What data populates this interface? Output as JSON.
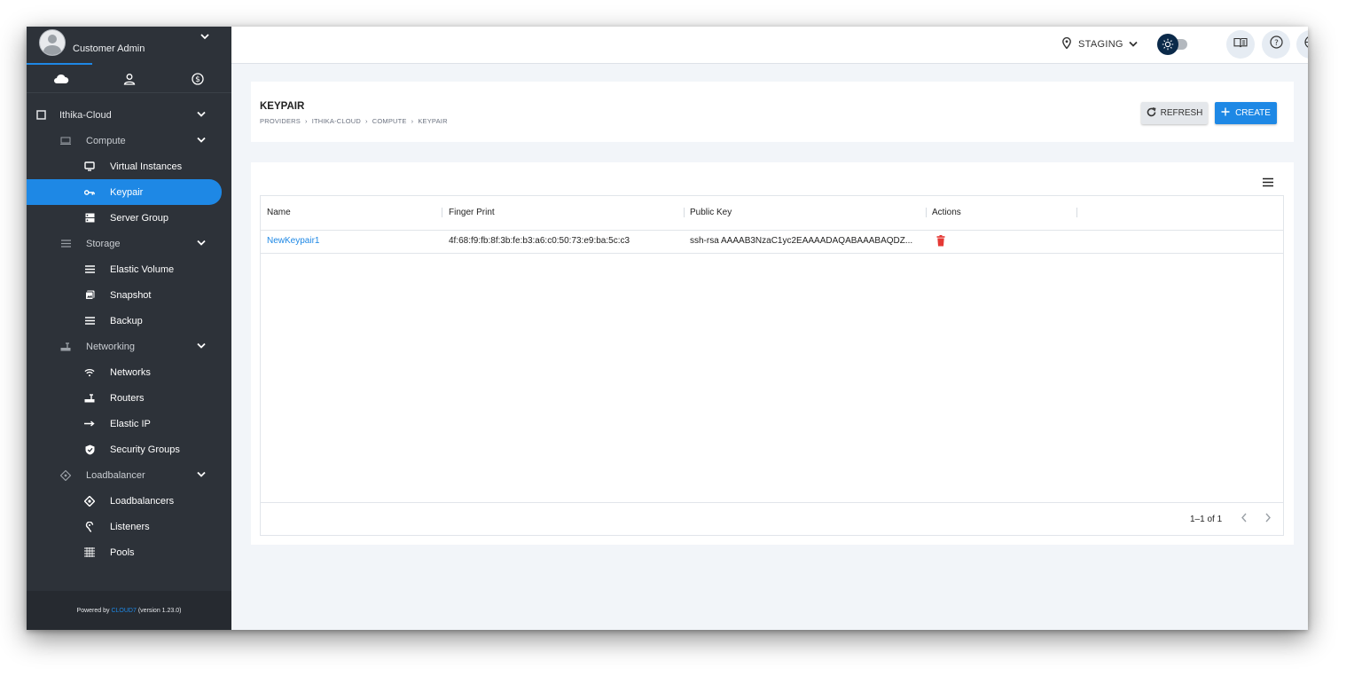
{
  "profile": {
    "name": "Customer Admin"
  },
  "sidebar": {
    "tabs": [
      {
        "icon": "cloud-icon"
      },
      {
        "icon": "user-icon"
      },
      {
        "icon": "billing-icon"
      }
    ],
    "items": [
      {
        "label": "Ithika-Cloud",
        "icon": "cloud-provider-icon"
      },
      {
        "label": "Compute",
        "icon": "compute-icon"
      },
      {
        "label": "Virtual Instances",
        "icon": "monitor-icon"
      },
      {
        "label": "Keypair",
        "icon": "key-icon",
        "active": true
      },
      {
        "label": "Server Group",
        "icon": "server-icon"
      },
      {
        "label": "Storage",
        "icon": "storage-icon"
      },
      {
        "label": "Elastic Volume",
        "icon": "volume-icon"
      },
      {
        "label": "Snapshot",
        "icon": "snapshot-icon"
      },
      {
        "label": "Backup",
        "icon": "backup-icon"
      },
      {
        "label": "Networking",
        "icon": "networking-icon"
      },
      {
        "label": "Networks",
        "icon": "wifi-icon"
      },
      {
        "label": "Routers",
        "icon": "router-icon"
      },
      {
        "label": "Elastic IP",
        "icon": "arrow-right-icon"
      },
      {
        "label": "Security Groups",
        "icon": "shield-icon"
      },
      {
        "label": "Loadbalancer",
        "icon": "loadbalancer-icon"
      },
      {
        "label": "Loadbalancers",
        "icon": "loadbalancers-icon"
      },
      {
        "label": "Listeners",
        "icon": "listener-icon"
      },
      {
        "label": "Pools",
        "icon": "pools-icon"
      }
    ],
    "footer": {
      "prefix": "Powered by",
      "brand": "CLOUD7",
      "version": "(version 1.23.0)"
    }
  },
  "topbar": {
    "environment": "STAGING"
  },
  "header": {
    "title": "KEYPAIR",
    "breadcrumb": [
      "PROVIDERS",
      "ITHIKA-CLOUD",
      "COMPUTE",
      "KEYPAIR"
    ],
    "breadcrumb_sep": "›",
    "refresh_label": "REFRESH",
    "create_label": "CREATE"
  },
  "table": {
    "columns": [
      "Name",
      "Finger Print",
      "Public Key",
      "Actions"
    ],
    "rows": [
      {
        "name": "NewKeypair1",
        "fingerprint": "4f:68:f9:fb:8f:3b:fe:b3:a6:c0:50:73:e9:ba:5c:c3",
        "public_key": "ssh-rsa AAAAB3NzaC1yc2EAAAADAQABAAABAQDZ..."
      }
    ],
    "pagination": "1–1 of 1"
  },
  "colors": {
    "accent": "#1e88e5",
    "sidebar": "#2d3239",
    "delete": "#e53935"
  }
}
